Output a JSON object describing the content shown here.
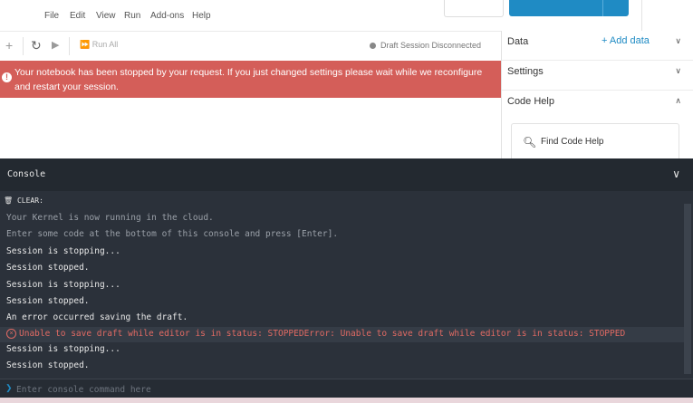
{
  "menu": [
    "File",
    "Edit",
    "View",
    "Run",
    "Add-ons",
    "Help"
  ],
  "toolbar": {
    "run_all": "Run All",
    "draft_status": "Draft Session Disconnected"
  },
  "alert": {
    "message": "Your notebook has been stopped by your request. If you just changed settings please wait while we reconfigure and restart your session."
  },
  "right_panel": {
    "data_title": "Data",
    "add_data": "+ Add data",
    "settings_title": "Settings",
    "code_help_title": "Code Help",
    "find_code_help": "Find Code Help"
  },
  "console": {
    "title": "Console",
    "clear_label": "CLEAR:",
    "lines": [
      {
        "text": "Your Kernel is now running in the cloud.",
        "style": "dim"
      },
      {
        "text": "Enter some code at the bottom of this console and press [Enter].",
        "style": "dim"
      },
      {
        "text": "Session is stopping...",
        "style": "norm"
      },
      {
        "text": "Session stopped.",
        "style": "norm"
      },
      {
        "text": "Session is stopping...",
        "style": "norm"
      },
      {
        "text": "Session stopped.",
        "style": "norm"
      },
      {
        "text": "An error occurred saving the draft.",
        "style": "norm"
      }
    ],
    "error_line": "Unable to save draft while editor is in status: STOPPEDError: Unable to save draft while editor is in status: STOPPED",
    "after_lines": [
      {
        "text": "Session is stopping...",
        "style": "norm"
      },
      {
        "text": "Session stopped.",
        "style": "norm"
      }
    ],
    "input_placeholder": "Enter console command here"
  },
  "colors": {
    "accent": "#1f8bc4",
    "alert_bg": "#d45e59",
    "console_bg": "#2b313a",
    "error_text": "#e06a63"
  }
}
